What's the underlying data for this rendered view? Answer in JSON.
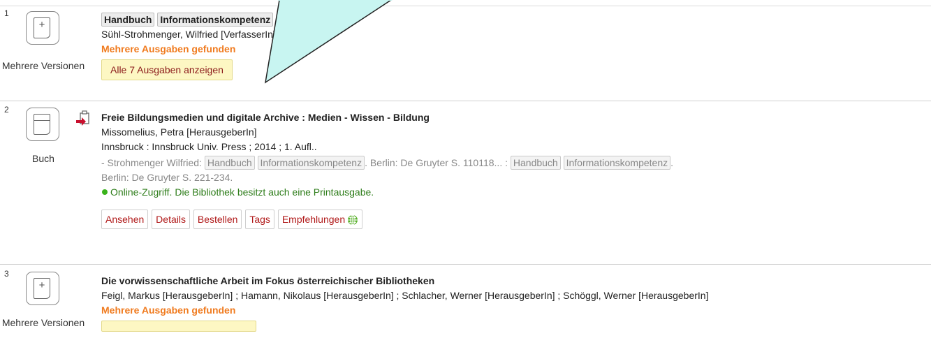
{
  "results": [
    {
      "number": "1",
      "type_label": "Mehrere Versionen",
      "title_hl": [
        "Handbuch",
        "Informationskompetenz"
      ],
      "authors": "Sühl-Strohmenger, Wilfried [VerfasserIn]",
      "multi_note": "Mehrere Ausgaben gefunden",
      "show_all": "Alle 7 Ausgaben anzeigen"
    },
    {
      "number": "2",
      "type_label": "Buch",
      "title": "Freie Bildungsmedien und digitale Archive : Medien - Wissen - Bildung",
      "authors": "Missomelius, Petra [HerausgeberIn]",
      "publisher": "Innsbruck : Innsbruck Univ. Press ; 2014 ; 1. Aufl..",
      "snippet": {
        "lead": "- Strohmenger Wilfried:",
        "hl1": "Handbuch",
        "hl2": "Informationskompetenz",
        "mid": ". Berlin: De Gruyter S. 110118... :",
        "hl3": "Handbuch",
        "hl4": "Informationskompetenz",
        "end": ".",
        "line2": "Berlin: De Gruyter S. 221-234."
      },
      "availability": "Online-Zugriff. Die Bibliothek besitzt auch eine Printausgabe.",
      "buttons": [
        "Ansehen",
        "Details",
        "Bestellen",
        "Tags",
        "Empfehlungen"
      ]
    },
    {
      "number": "3",
      "type_label": "Mehrere Versionen",
      "title": "Die vorwissenschaftliche Arbeit im Fokus österreichischer Bibliotheken",
      "authors": "Feigl, Markus [HerausgeberIn] ; Hamann, Nikolaus [HerausgeberIn] ; Schlacher, Werner [HerausgeberIn] ; Schöggl, Werner [HerausgeberIn]",
      "multi_note": "Mehrere Ausgaben gefunden"
    }
  ],
  "colors": {
    "multi_note": "#f07b1f",
    "button_text": "#b01818",
    "online": "#2e7d1a",
    "callout_fill": "#c8f5f1"
  }
}
